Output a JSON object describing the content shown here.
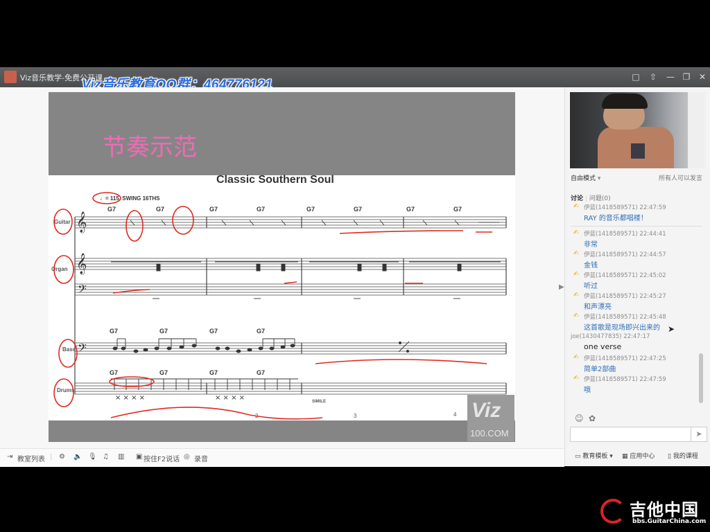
{
  "window": {
    "title": "Viz音乐教学-免费公开课",
    "overlay_text": "Viz音乐教育QQ群：464776121",
    "controls": [
      "□",
      "⇧",
      "—",
      "❐",
      "✕"
    ]
  },
  "slide": {
    "heading": "节奏示范",
    "sheet_title": "Classic Southern Soul",
    "tempo": "♩= 115. SWING 16THS",
    "instruments": [
      "Guitar",
      "Organ",
      "Bass",
      "Drums"
    ],
    "chord": "G7",
    "measure_numbers": [
      "2",
      "3",
      "4"
    ],
    "simile": "SIMILE",
    "watermark_logo": "Viz",
    "watermark_url": "100.COM"
  },
  "toolbar": {
    "class_list": "教室列表",
    "push_to_talk": "按住F2说话",
    "record": "录音"
  },
  "sidebar": {
    "mode": "自由模式",
    "all_can_speak": "所有人可以发言",
    "tab_discussion": "讨论",
    "tab_questions": "问题",
    "question_count": "(0)",
    "messages": [
      {
        "user": "伊蓝(1418589571)",
        "time": "22:47:59",
        "text": "RAY 的音乐都唱楼！"
      },
      {
        "user": "伊蓝(1418589571)",
        "time": "22:44:41",
        "text": "非常"
      },
      {
        "user": "伊蓝(1418589571)",
        "time": "22:44:57",
        "text": "金钱"
      },
      {
        "user": "伊蓝(1418589571)",
        "time": "22:45:02",
        "text": "听过"
      },
      {
        "user": "伊蓝(1418589571)",
        "time": "22:45:27",
        "text": "和声漂亮"
      },
      {
        "user": "伊蓝(1418589571)",
        "time": "22:45:48",
        "text": "这首歌是现场即兴出来的"
      },
      {
        "user": "joe(1430477835)",
        "time": "22:47:17",
        "text": "one verse"
      },
      {
        "user": "伊蓝(1418589571)",
        "time": "22:47:25",
        "text": "简单2部曲"
      },
      {
        "user": "伊蓝(1418589571)",
        "time": "22:47:59",
        "text": "哦"
      }
    ],
    "send_icon": "➤",
    "template_btn": "教育模板",
    "app_center": "应用中心",
    "my_courses": "我的课程"
  },
  "brand": {
    "name": "吉他中国",
    "url": "bbs.GuitarChina.com"
  },
  "colors": {
    "heading_pink": "#f06bb6",
    "overlay_blue": "#2b6de0",
    "annotation_red": "#e0291f",
    "chat_blue": "#2f6db5"
  }
}
